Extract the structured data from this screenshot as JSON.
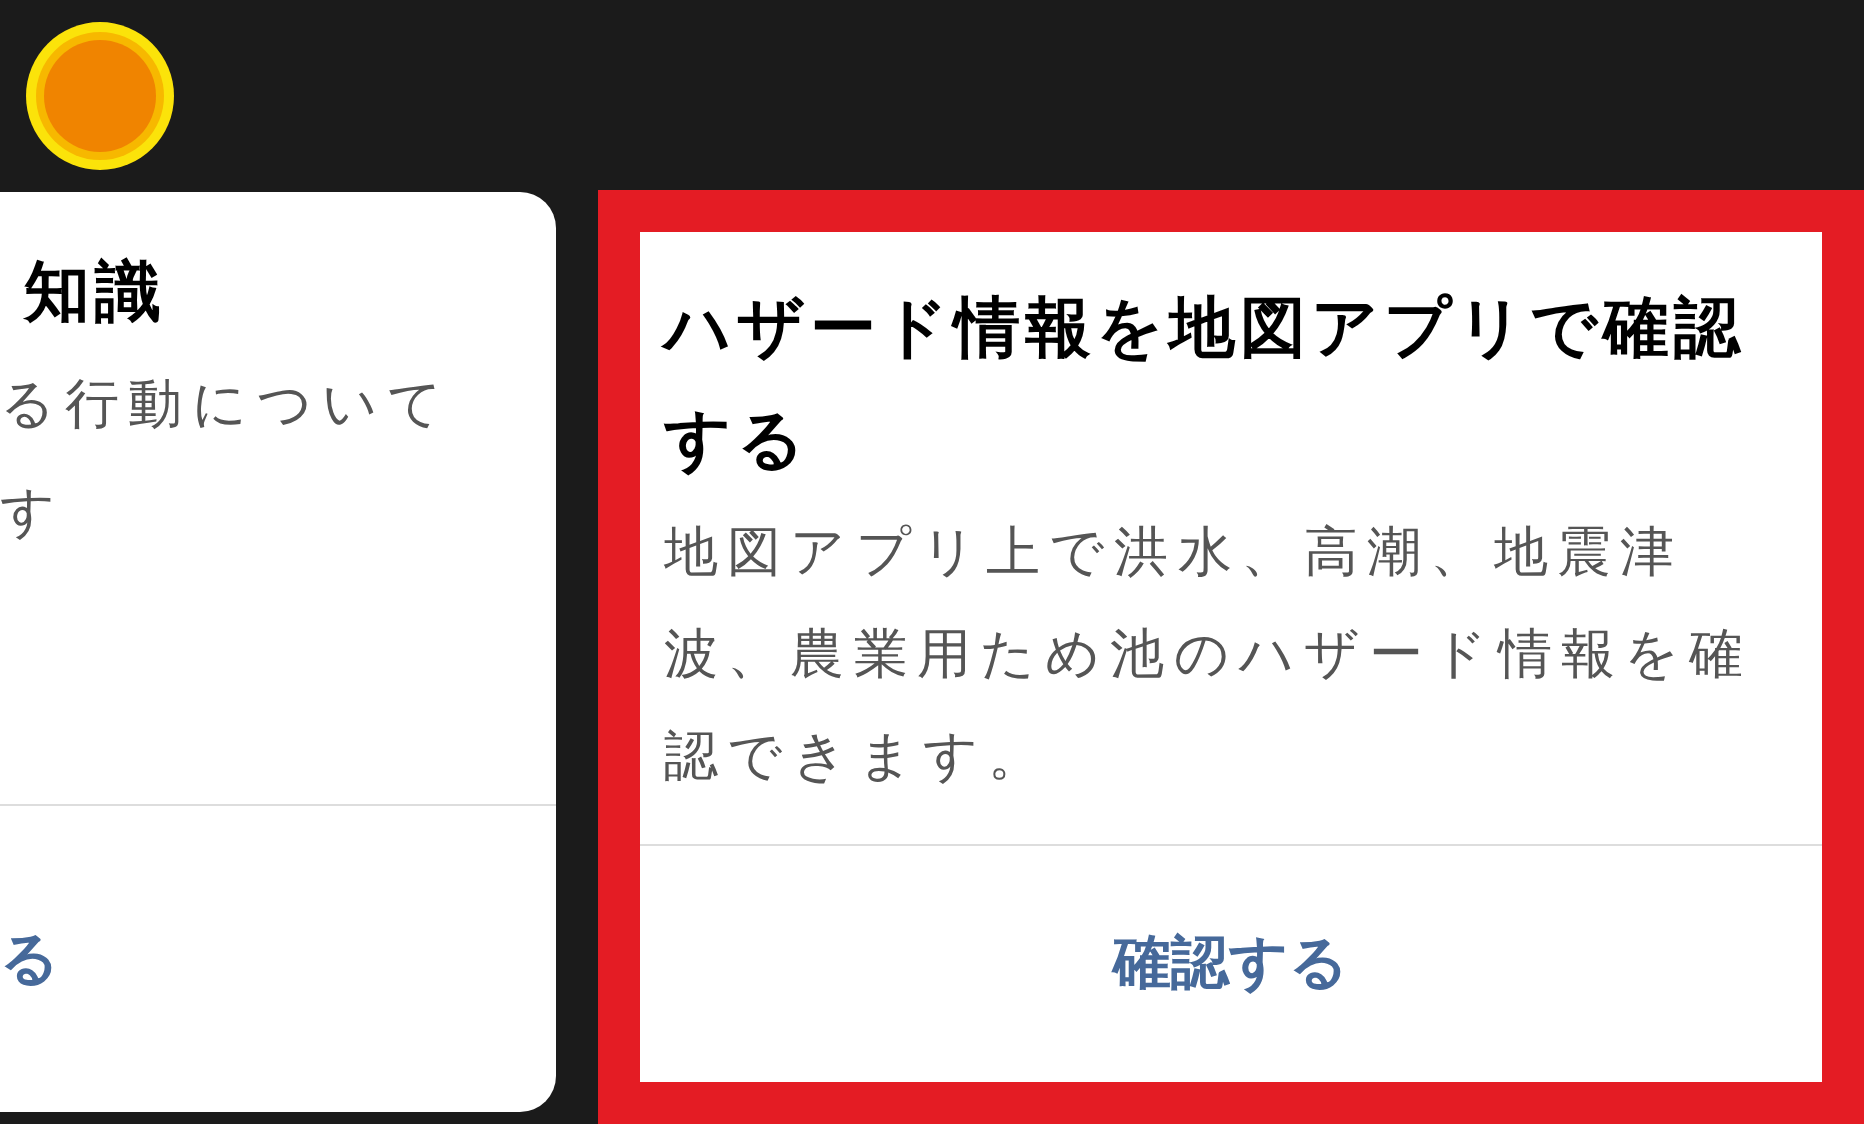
{
  "cards": [
    {
      "title": "知識",
      "body": [
        "る行動について",
        "す"
      ],
      "action": "る",
      "highlighted": false
    },
    {
      "title": "ハザード情報を地図アプリで確認する",
      "body": [
        "地図アプリ上で洪水、高潮、地震津波、農業用ため池のハザード情報を確認できます。"
      ],
      "action": "確認する",
      "highlighted": true
    }
  ]
}
